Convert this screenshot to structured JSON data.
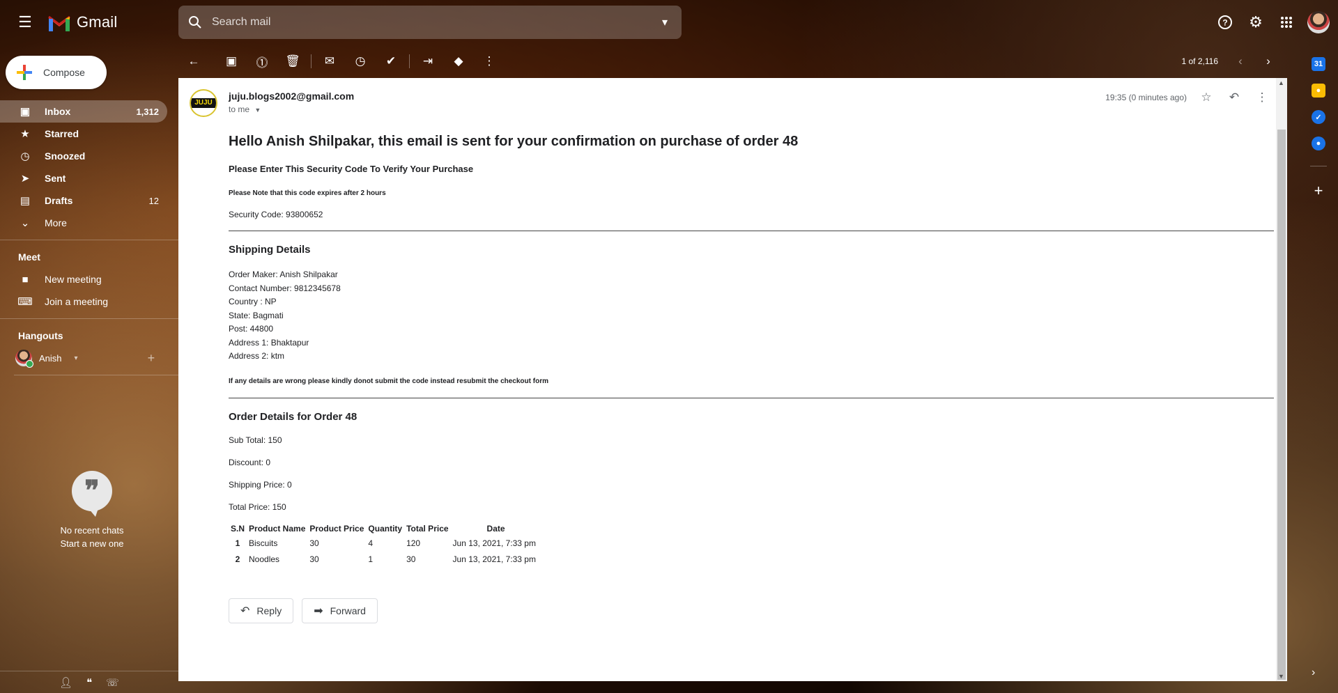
{
  "app": {
    "name": "Gmail"
  },
  "search": {
    "placeholder": "Search mail"
  },
  "sidebar": {
    "compose_label": "Compose",
    "items": [
      {
        "label": "Inbox",
        "count": "1,312",
        "icon": "inbox-icon"
      },
      {
        "label": "Starred",
        "count": "",
        "icon": "star-icon"
      },
      {
        "label": "Snoozed",
        "count": "",
        "icon": "clock-icon"
      },
      {
        "label": "Sent",
        "count": "",
        "icon": "send-icon"
      },
      {
        "label": "Drafts",
        "count": "12",
        "icon": "draft-icon"
      },
      {
        "label": "More",
        "count": "",
        "icon": "chevron-down-icon"
      }
    ],
    "meet_title": "Meet",
    "meet_items": [
      "New meeting",
      "Join a meeting"
    ],
    "hangouts_title": "Hangouts",
    "hangouts_user": "Anish",
    "no_chats": "No recent chats",
    "start_new": "Start a new one"
  },
  "toolbar": {
    "pager": "1 of 2,116"
  },
  "message": {
    "sender": "juju.blogs2002@gmail.com",
    "to": "to me",
    "time": "19:35 (0 minutes ago)",
    "avatar_text": "JUJU",
    "heading": "Hello Anish Shilpakar, this email is sent for your confirmation on purchase of order 48",
    "enter_code": "Please Enter This Security Code To Verify Your Purchase",
    "expiry_note": "Please Note that this code expires after 2 hours",
    "security_code": "Security Code: 93800652",
    "shipping_title": "Shipping Details",
    "shipping_lines": [
      "Order Maker: Anish Shilpakar",
      "Contact Number: 9812345678",
      "Country : NP",
      "State: Bagmati",
      "Post: 44800",
      "Address 1: Bhaktapur",
      "Address 2: ktm"
    ],
    "warning": "If any details are wrong please kindly donot submit the code instead resubmit the checkout form",
    "order_title": "Order Details for Order 48",
    "sub_total": "Sub Total: 150",
    "discount": "Discount: 0",
    "shipping_price": "Shipping Price: 0",
    "total_price": "Total Price: 150",
    "table": {
      "headers": [
        "S.N",
        "Product Name",
        "Product Price",
        "Quantity",
        "Total Price",
        "Date"
      ],
      "rows": [
        [
          "1",
          "Biscuits",
          "30",
          "4",
          "120",
          "Jun 13, 2021, 7:33 pm"
        ],
        [
          "2",
          "Noodles",
          "30",
          "1",
          "30",
          "Jun 13, 2021, 7:33 pm"
        ]
      ]
    },
    "reply_label": "Reply",
    "forward_label": "Forward"
  },
  "colors": {
    "accent": "#1a73e8",
    "gmail_red": "#ea4335"
  }
}
